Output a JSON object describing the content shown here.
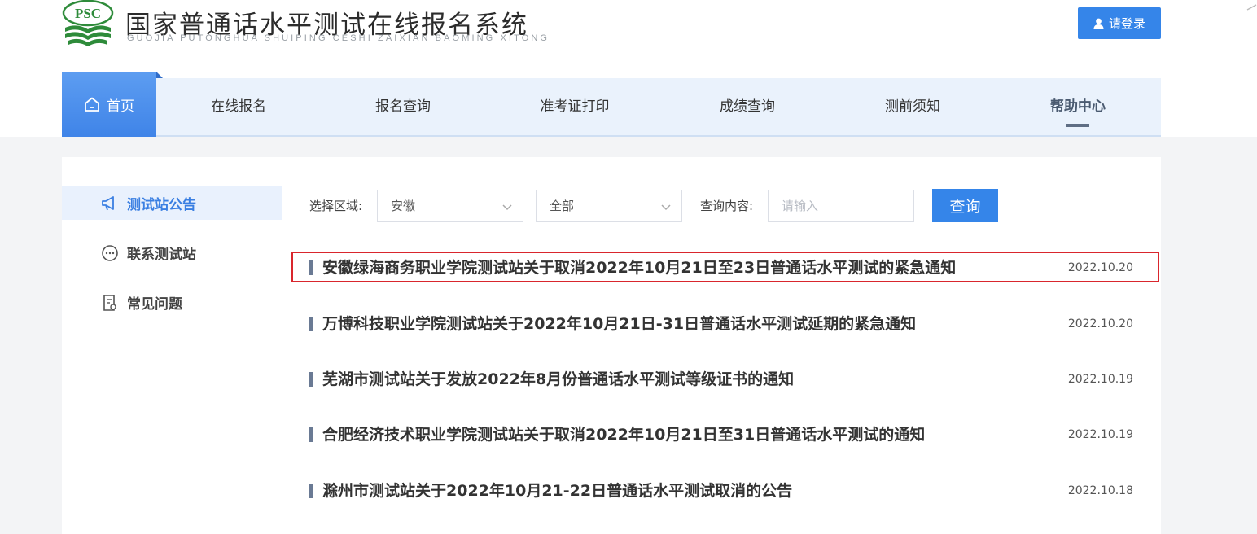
{
  "header": {
    "logo_text": "PSC",
    "title": "国家普通话水平测试在线报名系统",
    "subtitle": "GUOJIA PUTONGHUA SHUIPING CESHI ZAIXIAN BAOMING XITONG",
    "login_label": "请登录"
  },
  "colors": {
    "primary": "#3585e9",
    "nav_bg": "#eaf2fc",
    "highlight": "#d9262d",
    "logo_green": "#2e8b3a"
  },
  "nav": {
    "home_label": "首页",
    "items": [
      {
        "label": "在线报名"
      },
      {
        "label": "报名查询"
      },
      {
        "label": "准考证打印"
      },
      {
        "label": "成绩查询"
      },
      {
        "label": "测前须知"
      },
      {
        "label": "帮助中心",
        "active": true
      }
    ]
  },
  "sidebar": {
    "items": [
      {
        "label": "测试站公告",
        "icon": "megaphone-icon",
        "active": true
      },
      {
        "label": "联系测试站",
        "icon": "chat-icon"
      },
      {
        "label": "常见问题",
        "icon": "faq-document-icon"
      }
    ]
  },
  "filter": {
    "region_label": "选择区域:",
    "region_value": "安徽",
    "scope_value": "全部",
    "query_label": "查询内容:",
    "query_placeholder": "请输入",
    "query_button": "查询"
  },
  "notices": [
    {
      "title": "安徽绿海商务职业学院测试站关于取消2022年10月21日至23日普通话水平测试的紧急通知",
      "date": "2022.10.20",
      "highlighted": true
    },
    {
      "title": "万博科技职业学院测试站关于2022年10月21日-31日普通话水平测试延期的紧急通知",
      "date": "2022.10.20"
    },
    {
      "title": "芜湖市测试站关于发放2022年8月份普通话水平测试等级证书的通知",
      "date": "2022.10.19"
    },
    {
      "title": "合肥经济技术职业学院测试站关于取消2022年10月21日至31日普通话水平测试的通知",
      "date": "2022.10.19"
    },
    {
      "title": "滁州市测试站关于2022年10月21-22日普通话水平测试取消的公告",
      "date": "2022.10.18"
    }
  ]
}
